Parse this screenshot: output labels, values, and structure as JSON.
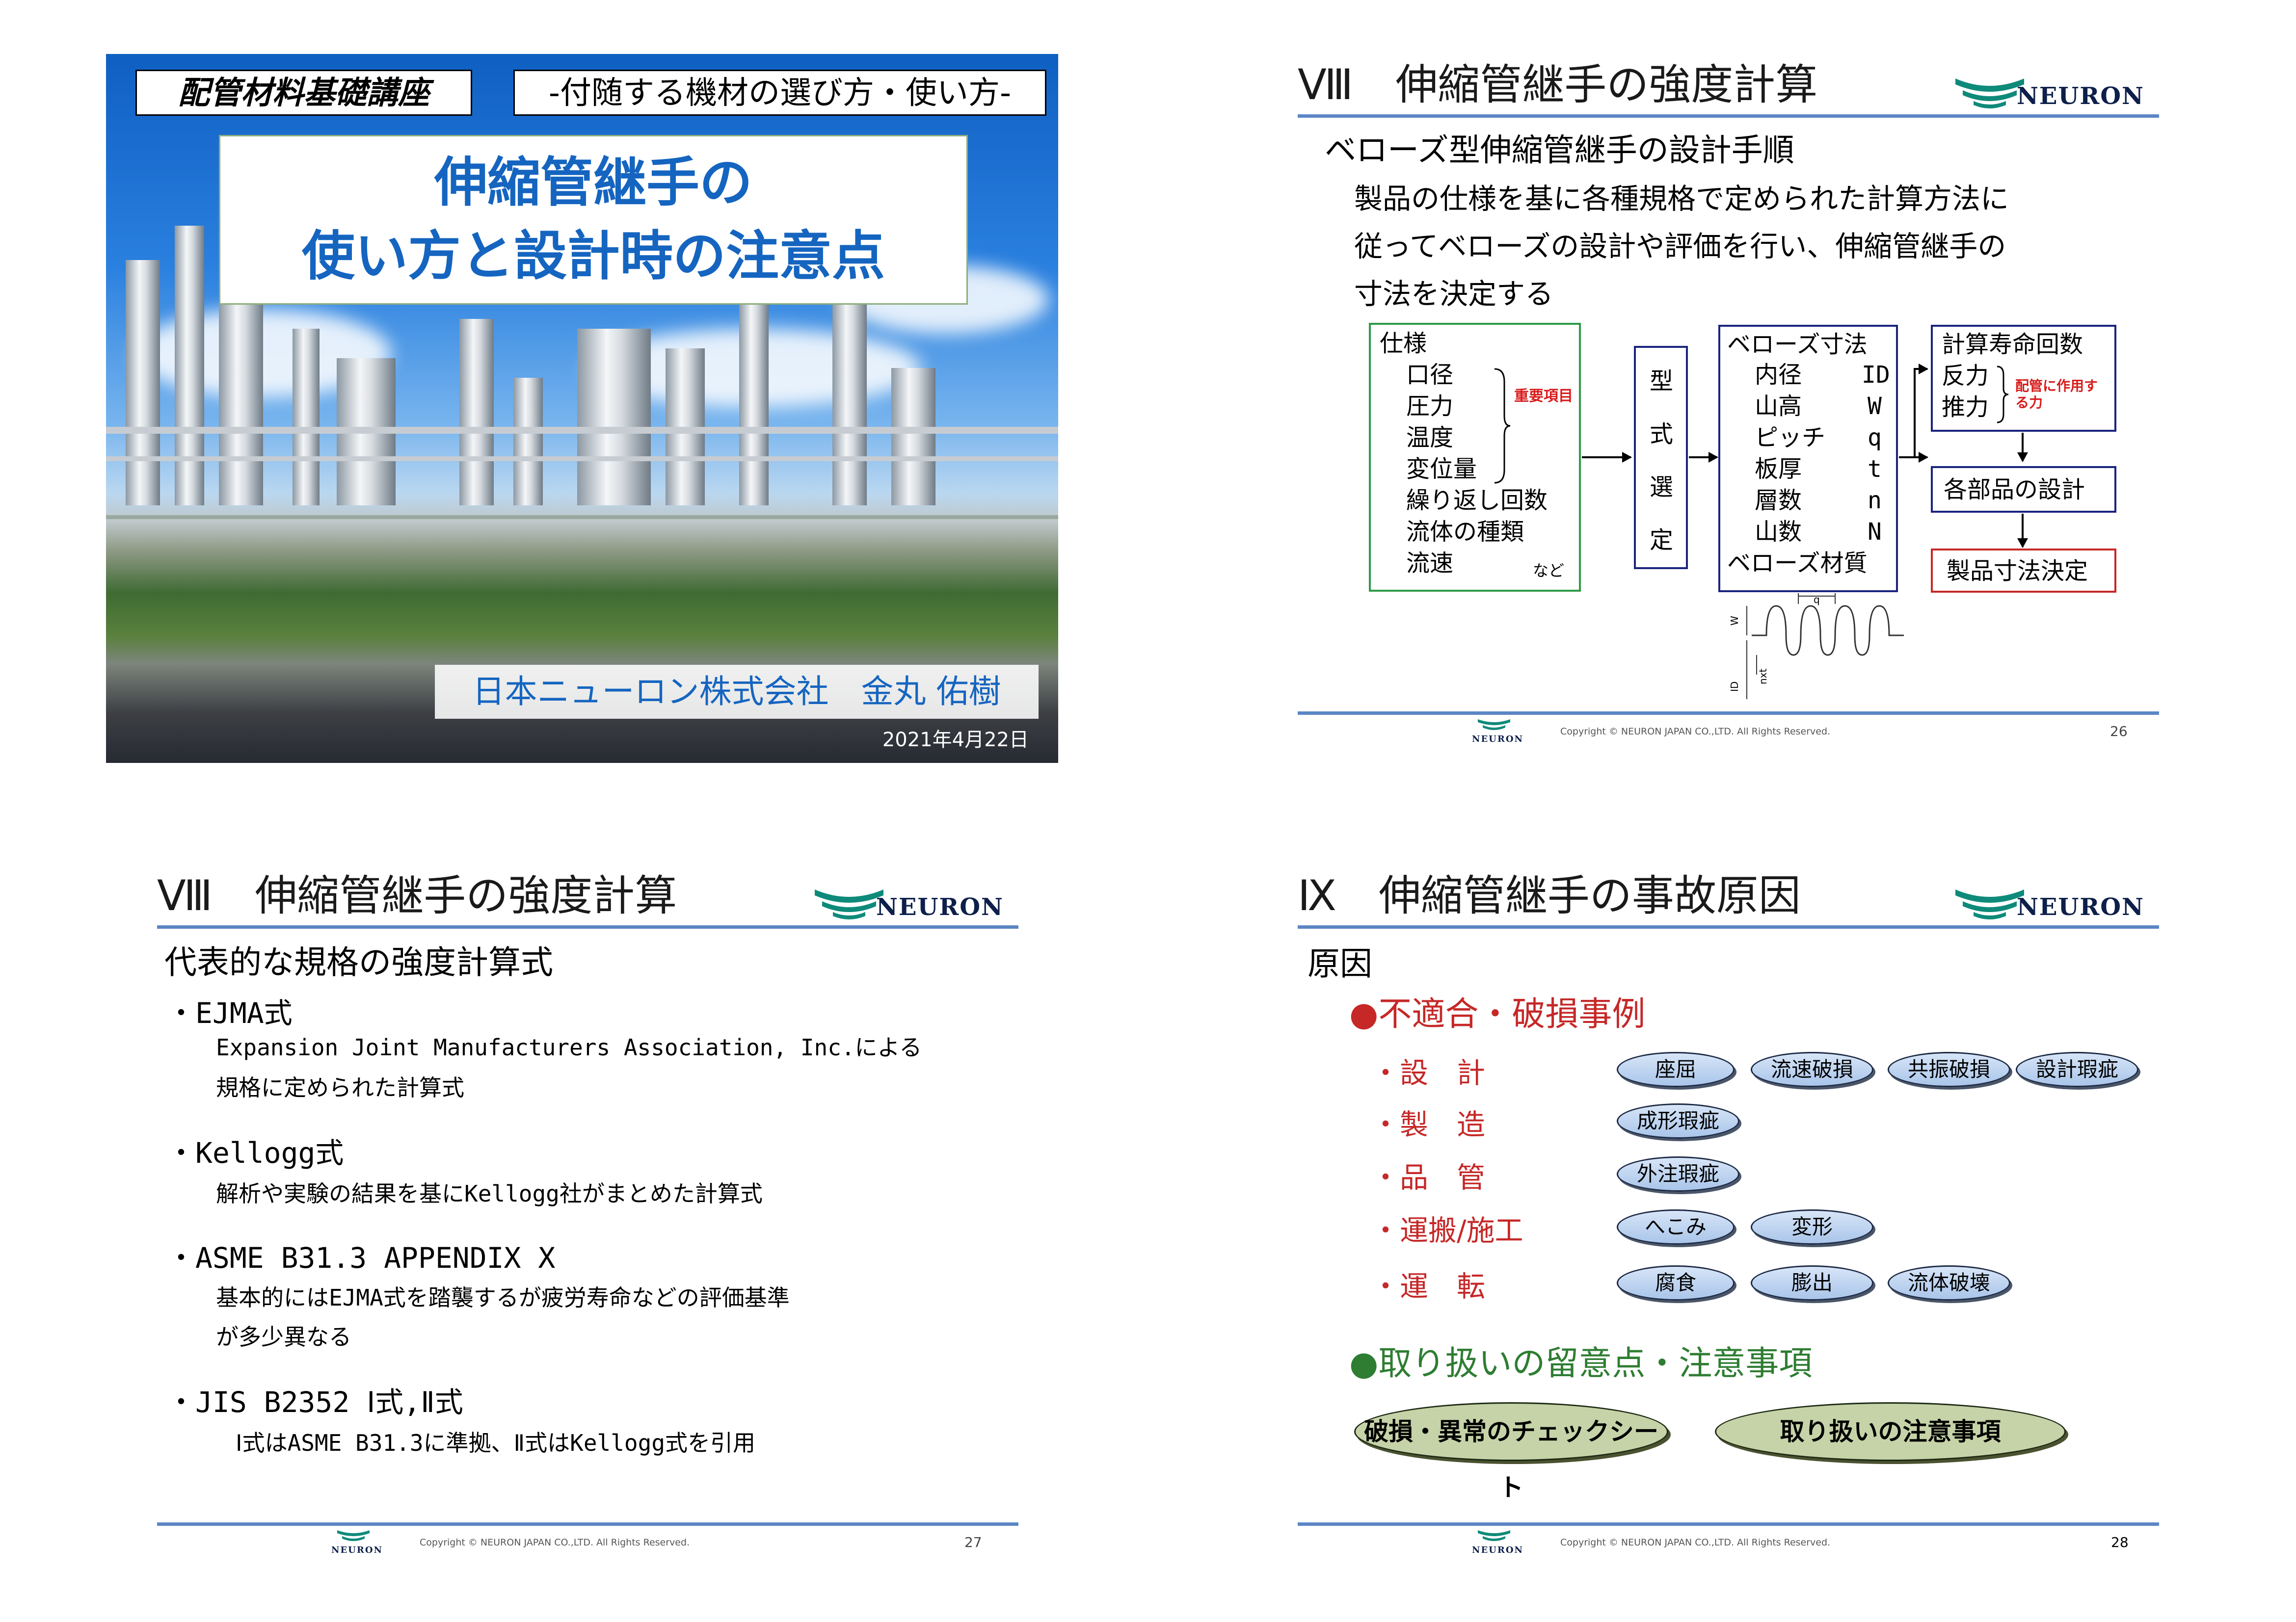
{
  "slide1": {
    "course": "配管材料基礎講座",
    "subtitle": "-付随する機材の選び方・使い方-",
    "title_line1": "伸縮管継手の",
    "title_line2": "使い方と設計時の注意点",
    "author": "日本ニューロン株式会社　金丸 佑樹",
    "date": "2021年4月22日"
  },
  "brand": {
    "logo": "NEURON",
    "copyright": "Copyright © NEURON JAPAN CO.,LTD. All Rights Reserved.",
    "rule_color": "#5b86c4"
  },
  "slide2": {
    "title": "Ⅷ　伸縮管継手の強度計算",
    "heading": "ベローズ型伸縮管継手の設計手順",
    "body": [
      "製品の仕様を基に各種規格で定められた計算方法に",
      "従ってベローズの設計や評価を行い、伸縮管継手の",
      "寸法を決定する"
    ],
    "spec_box": {
      "head": "仕様",
      "items": [
        "口径",
        "圧力",
        "温度",
        "変位量",
        "繰り返し回数",
        "流体の種類",
        "流速"
      ],
      "note": "重要項目",
      "etc": "など"
    },
    "type_box": [
      "型",
      "式",
      "選",
      "定"
    ],
    "bellows_box": {
      "head": "ベローズ寸法",
      "rows": [
        [
          "内径",
          "ID"
        ],
        [
          "山高",
          "W"
        ],
        [
          "ピッチ",
          "q"
        ],
        [
          "板厚",
          "t"
        ],
        [
          "層数",
          "n"
        ],
        [
          "山数",
          "N"
        ]
      ],
      "tail": "ベローズ材質"
    },
    "calc_box": {
      "head": "計算寿命回数",
      "items": [
        "反力",
        "推力"
      ],
      "note": "配管に作用する力"
    },
    "parts_box": "各部品の設計",
    "final_box": "製品寸法決定",
    "diagram_labels": {
      "q": "q",
      "w": "W",
      "id": "ID",
      "nxt": "nxt"
    },
    "page": "26"
  },
  "slide3": {
    "title": "Ⅷ　伸縮管継手の強度計算",
    "heading": "代表的な規格の強度計算式",
    "items": [
      {
        "name": "・EJMA式",
        "desc": [
          "Expansion Joint Manufacturers Association, Inc.による",
          "規格に定められた計算式"
        ]
      },
      {
        "name": "・Kellogg式",
        "desc": [
          "解析や実験の結果を基にKellogg社がまとめた計算式"
        ]
      },
      {
        "name": "・ASME B31.3 APPENDIX X",
        "desc": [
          "基本的にはEJMA式を踏襲するが疲労寿命などの評価基準",
          "が多少異なる"
        ]
      },
      {
        "name": "・JIS B2352 Ⅰ式,Ⅱ式",
        "desc": [
          "Ⅰ式はASME B31.3に準拠、Ⅱ式はKellogg式を引用"
        ]
      }
    ],
    "page": "27"
  },
  "slide4": {
    "title": "Ⅸ　伸縮管継手の事故原因",
    "heading": "原因",
    "section1": "●不適合・破損事例",
    "categories": [
      {
        "label": "・設　計",
        "tags": [
          "座屈",
          "流速破損",
          "共振破損",
          "設計瑕疵"
        ]
      },
      {
        "label": "・製　造",
        "tags": [
          "成形瑕疵"
        ]
      },
      {
        "label": "・品　管",
        "tags": [
          "外注瑕疵"
        ]
      },
      {
        "label": "・運搬/施工",
        "tags": [
          "へこみ",
          "変形"
        ]
      },
      {
        "label": "・運　転",
        "tags": [
          "腐食",
          "膨出",
          "流体破壊"
        ]
      }
    ],
    "section2": "●取り扱いの留意点・注意事項",
    "buttons": [
      "破損・異常のチェックシート",
      "取り扱いの注意事項"
    ],
    "page": "28"
  }
}
